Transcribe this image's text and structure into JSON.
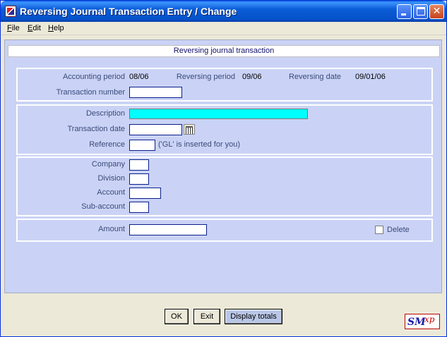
{
  "window": {
    "title": "Reversing Journal Transaction Entry / Change",
    "icon": "app-icon",
    "controls": {
      "minimize": "minimize-icon",
      "maximize": "maximize-icon",
      "close": "✕"
    }
  },
  "menu": {
    "file": {
      "underline": "F",
      "rest": "ile"
    },
    "edit": {
      "underline": "E",
      "rest": "dit"
    },
    "help": {
      "underline": "H",
      "rest": "elp"
    }
  },
  "header": {
    "title": "Reversing journal transaction"
  },
  "periods": {
    "accounting_label": "Accounting period",
    "accounting_value": "08/06",
    "reversing_label": "Reversing period",
    "reversing_value": "09/06",
    "reversing_date_label": "Reversing date",
    "reversing_date_value": "09/01/06",
    "transaction_number_label": "Transaction number",
    "transaction_number_value": ""
  },
  "details": {
    "description_label": "Description",
    "description_value": "",
    "transaction_date_label": "Transaction  date",
    "transaction_date_value": "",
    "reference_label": "Reference",
    "reference_value": "",
    "reference_note": "('GL' is inserted for you)"
  },
  "account": {
    "company_label": "Company",
    "division_label": "Division",
    "account_label": "Account",
    "subaccount_label": "Sub-account",
    "company_value": "",
    "division_value": "",
    "account_value": "",
    "subaccount_value": ""
  },
  "amount": {
    "label": "Amount",
    "value": "",
    "delete_label": "Delete",
    "delete_checked": false
  },
  "buttons": {
    "ok": "OK",
    "exit": "Exit",
    "display_totals": "Display totals"
  },
  "logo": {
    "sm": "SM",
    "xp": "xp"
  },
  "colors": {
    "title_bar": "#0552c9",
    "client_bg": "#cad3f5",
    "label_text": "#3b4a7a",
    "highlight_field": "#00ffff",
    "field_border": "#0a1e8c"
  }
}
